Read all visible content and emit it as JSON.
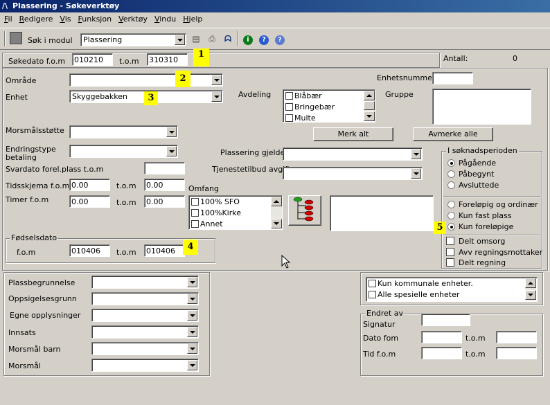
{
  "window": {
    "title": "Plassering - Søkeverktøy"
  },
  "menu": [
    "Fil",
    "Redigere",
    "Vis",
    "Funksjon",
    "Verktøy",
    "Vindu",
    "Hjelp"
  ],
  "toolbar": {
    "search_label": "Søk i modul",
    "module_value": "Plassering"
  },
  "top": {
    "sokedato_label": "Søkedato f.o.m",
    "sokedato_from": "010210",
    "tom_label": "t.o.m",
    "sokedato_to": "310310",
    "antall_label": "Antall:",
    "antall_value": "0"
  },
  "main": {
    "omrade_label": "Område",
    "enhet_label": "Enhet",
    "enhet_value": "Skyggebakken",
    "avdeling_label": "Avdeling",
    "avdeling_items": [
      "Blåbær",
      "Bringebær",
      "Multe"
    ],
    "enhetsnummer_label": "Enhetsnummer",
    "gruppe_label": "Gruppe",
    "merk_alt": "Merk alt",
    "avmerke_alle": "Avmerke alle",
    "morsmalsstotte_label": "Morsmålsstøtte",
    "endringstype_label": "Endringstype betaling",
    "plassering_gjelder_label": "Plassering gjelder",
    "svardato_label": "Svardato forel.plass t.o.m",
    "tjenestetilbud_label": "Tjenestetilbud avgift",
    "tidsskjema_label": "Tidsskjema f.o.m",
    "tidsskjema_from": "0.00",
    "tidsskjema_to": "0.00",
    "timer_label": "Timer f.o.m",
    "timer_from": "0.00",
    "timer_to": "0.00",
    "tom_label": "t.o.m",
    "omfang_label": "Omfang",
    "omfang_items": [
      "100% SFO",
      "100%Kirke",
      "Annet"
    ],
    "fodselsdato_legend": "Fødselsdato",
    "fom_label": "f.o.m",
    "fodsel_from": "010406",
    "fodsel_to": "010406"
  },
  "soknad": {
    "legend": "I søknadsperioden",
    "radios1": [
      {
        "label": "Pågående",
        "checked": true
      },
      {
        "label": "Påbegynt",
        "checked": false
      },
      {
        "label": "Avsluttede",
        "checked": false
      }
    ],
    "radios2": [
      {
        "label": "Foreløpig og ordinær",
        "checked": false
      },
      {
        "label": "Kun fast plass",
        "checked": false
      },
      {
        "label": "Kun foreløpige",
        "checked": true
      }
    ],
    "checks": [
      "Delt omsorg",
      "Avv regningsmottaker",
      "Delt regning"
    ]
  },
  "lower": {
    "fields": [
      "Plassbegrunnelse",
      "Oppsigelsesgrunn",
      "Egne opplysninger",
      "Innsats",
      "Morsmål barn",
      "Morsmål"
    ],
    "kommunale": "Kun kommunale enheter.",
    "spesielle": "Alle spesielle enheter",
    "endret_legend": "Endret av",
    "signatur_label": "Signatur",
    "dato_fom_label": "Dato fom",
    "tid_fom_label": "Tid f.o.m",
    "tom_label": "t.o.m"
  },
  "markers": [
    "1",
    "2",
    "3",
    "4",
    "5"
  ],
  "colors": {
    "titlebar": "#0a246a",
    "face": "#d4d0c8",
    "marker": "#ffff00"
  }
}
